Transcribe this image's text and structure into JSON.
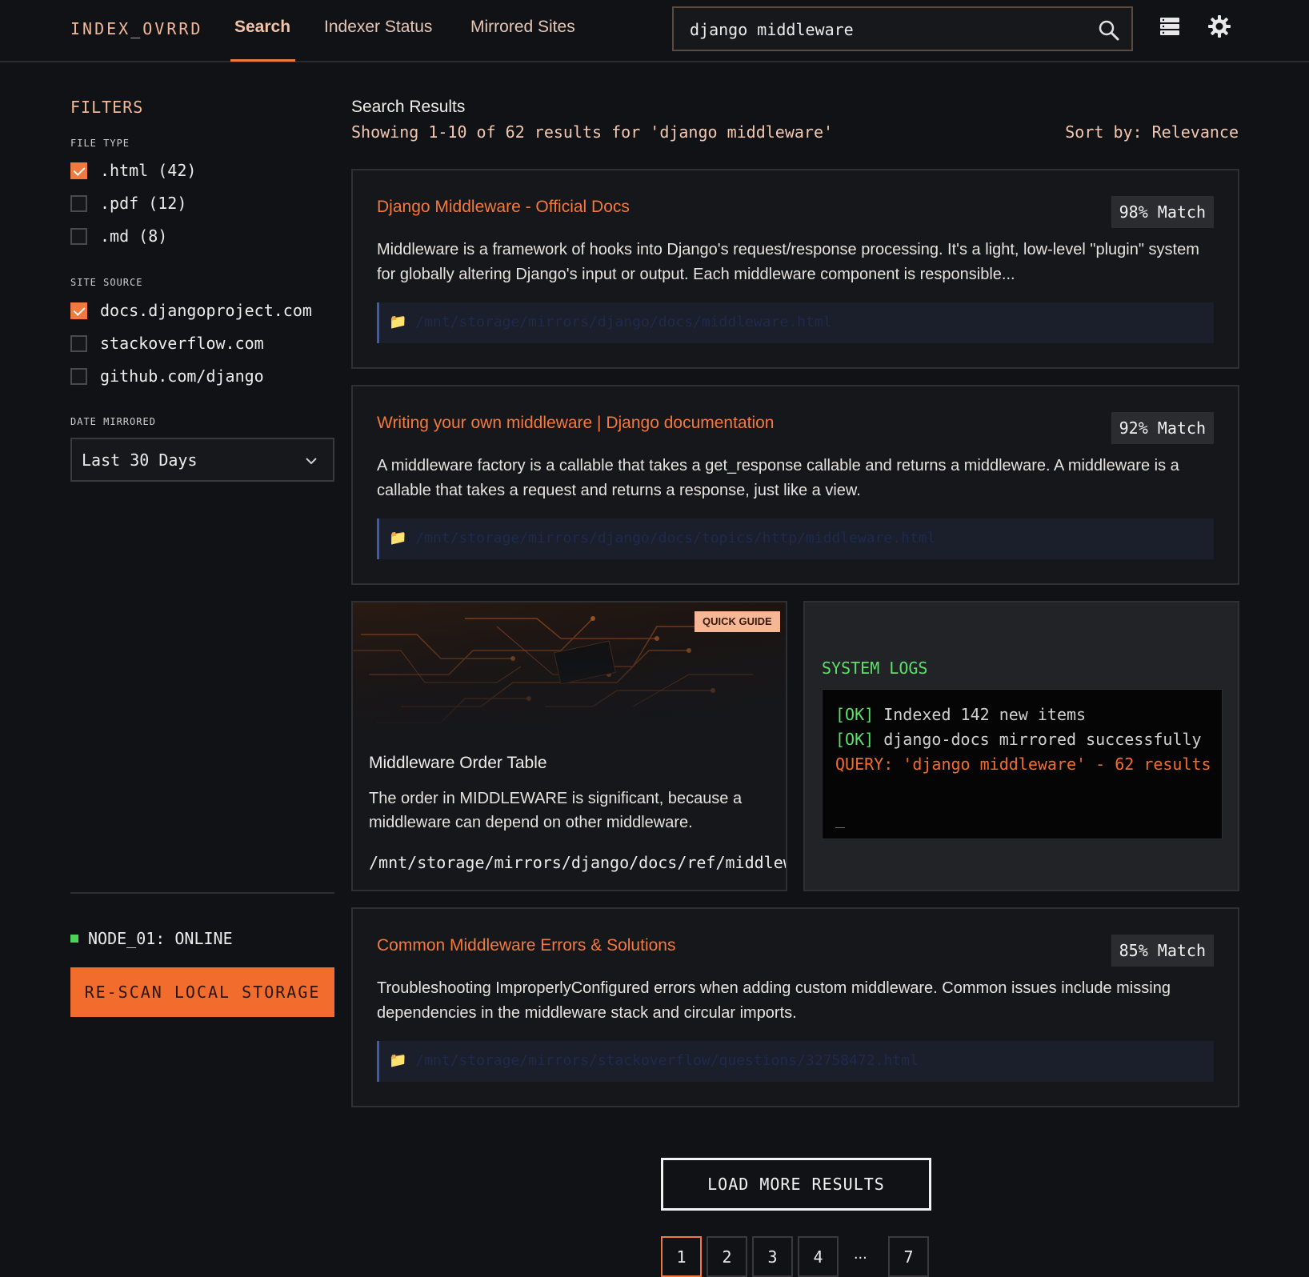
{
  "header": {
    "brand": "INDEX_OVRRD",
    "tabs": [
      {
        "label": "Search",
        "active": true
      },
      {
        "label": "Indexer Status",
        "active": false
      },
      {
        "label": "Mirrored Sites",
        "active": false
      }
    ],
    "search_value": "django middleware",
    "icons": [
      "search-icon",
      "storage-icon",
      "gear-icon"
    ]
  },
  "sidebar": {
    "title": "FILTERS",
    "file_type_label": "FILE TYPE",
    "file_types": [
      {
        "label": ".html (42)",
        "checked": true
      },
      {
        "label": ".pdf (12)",
        "checked": false
      },
      {
        "label": ".md (8)",
        "checked": false
      }
    ],
    "site_source_label": "SITE SOURCE",
    "site_sources": [
      {
        "label": "docs.djangoproject.com",
        "checked": true
      },
      {
        "label": "stackoverflow.com",
        "checked": false
      },
      {
        "label": "github.com/django",
        "checked": false
      }
    ],
    "date_label": "DATE MIRRORED",
    "date_value": "Last 30 Days",
    "node_status": "NODE_01: ONLINE",
    "rescan_label": "RE-SCAN LOCAL STORAGE"
  },
  "results": {
    "title": "Search Results",
    "summary": "Showing 1-10 of 62 results for 'django middleware'",
    "sort": "Sort by: Relevance",
    "items": [
      {
        "title": "Django Middleware - Official Docs",
        "match": "98% Match",
        "snippet": "Middleware is a framework of hooks into Django's request/response processing. It's a light, low-level \"plugin\" system for globally altering Django's input or output. Each middleware component is responsible...",
        "path": "📁 /mnt/storage/mirrors/django/docs/middleware.html"
      },
      {
        "title": "Writing your own middleware | Django documentation",
        "match": "92% Match",
        "snippet": "A middleware factory is a callable that takes a get_response callable and returns a middleware. A middleware is a callable that takes a request and returns a response, just like a view.",
        "path": "📁 /mnt/storage/mirrors/django/docs/topics/http/middleware.html"
      },
      {
        "title": "Common Middleware Errors & Solutions",
        "match": "85% Match",
        "snippet": "Troubleshooting ImproperlyConfigured errors when adding custom middleware. Common issues include missing dependencies in the middleware stack and circular imports.",
        "path": "📁 /mnt/storage/mirrors/stackoverflow/questions/32758472.html"
      }
    ],
    "guide": {
      "badge": "QUICK GUIDE",
      "title": "Middleware Order Table",
      "text": "The order in MIDDLEWARE is significant, because a middleware can depend on other middleware.",
      "path": "/mnt/storage/mirrors/django/docs/ref/middleware.html"
    },
    "logs": {
      "title": "SYSTEM LOGS",
      "ok_tag": "[OK]",
      "line1": " Indexed 142 new items",
      "line2": " django-docs mirrored successfully",
      "query": "QUERY: 'django middleware' - 62 results",
      "cursor": "_"
    }
  },
  "footer": {
    "load_more": "LOAD MORE RESULTS",
    "pages": [
      "1",
      "2",
      "3",
      "4",
      "7"
    ],
    "ellipsis": "...",
    "current_page": "1"
  },
  "colors": {
    "accent": "#f26c2e",
    "ok": "#5be06a",
    "background": "#111216"
  }
}
